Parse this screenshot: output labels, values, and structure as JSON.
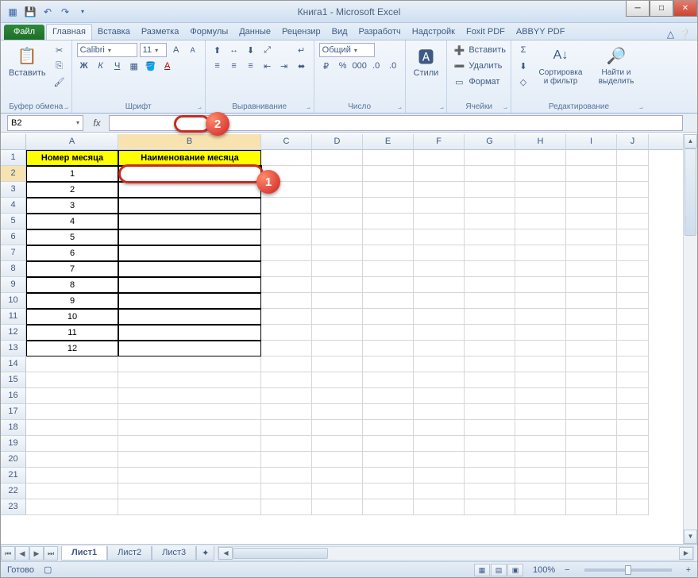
{
  "title": "Книга1  -  Microsoft Excel",
  "qat_icons": [
    "excel-icon",
    "save-icon",
    "undo-icon",
    "redo-icon"
  ],
  "tabs": {
    "file": "Файл",
    "items": [
      "Главная",
      "Вставка",
      "Разметка",
      "Формулы",
      "Данные",
      "Рецензир",
      "Вид",
      "Разработч",
      "Надстройк",
      "Foxit PDF",
      "ABBYY PDF"
    ],
    "active": "Главная"
  },
  "ribbon": {
    "clipboard": {
      "paste": "Вставить",
      "label": "Буфер обмена"
    },
    "font": {
      "name": "Calibri",
      "size": "11",
      "label": "Шрифт"
    },
    "align": {
      "label": "Выравнивание"
    },
    "number": {
      "format": "Общий",
      "label": "Число"
    },
    "styles": {
      "btn": "Стили",
      "label": ""
    },
    "cells": {
      "insert": "Вставить",
      "delete": "Удалить",
      "format": "Формат",
      "label": "Ячейки"
    },
    "editing": {
      "sort": "Сортировка и фильтр",
      "find": "Найти и выделить",
      "label": "Редактирование"
    }
  },
  "namebox": "B2",
  "fx_label": "fx",
  "columns": [
    "A",
    "B",
    "C",
    "D",
    "E",
    "F",
    "G",
    "H",
    "I",
    "J"
  ],
  "selected_col": "B",
  "selected_row": 2,
  "headers": {
    "A": "Номер месяца",
    "B": "Наименование месяца"
  },
  "data_rows": [
    {
      "n": 1,
      "a": "1",
      "b": ""
    },
    {
      "n": 2,
      "a": "2",
      "b": ""
    },
    {
      "n": 3,
      "a": "3",
      "b": ""
    },
    {
      "n": 4,
      "a": "4",
      "b": ""
    },
    {
      "n": 5,
      "a": "5",
      "b": ""
    },
    {
      "n": 6,
      "a": "6",
      "b": ""
    },
    {
      "n": 7,
      "a": "7",
      "b": ""
    },
    {
      "n": 8,
      "a": "8",
      "b": ""
    },
    {
      "n": 9,
      "a": "9",
      "b": ""
    },
    {
      "n": 10,
      "a": "10",
      "b": ""
    },
    {
      "n": 11,
      "a": "11",
      "b": ""
    },
    {
      "n": 12,
      "a": "12",
      "b": ""
    }
  ],
  "empty_rows": [
    14,
    15,
    16,
    17,
    18,
    19,
    20,
    21,
    22,
    23
  ],
  "sheets": [
    "Лист1",
    "Лист2",
    "Лист3"
  ],
  "active_sheet": "Лист1",
  "status_text": "Готово",
  "zoom": "100%",
  "callouts": {
    "1": "1",
    "2": "2"
  }
}
